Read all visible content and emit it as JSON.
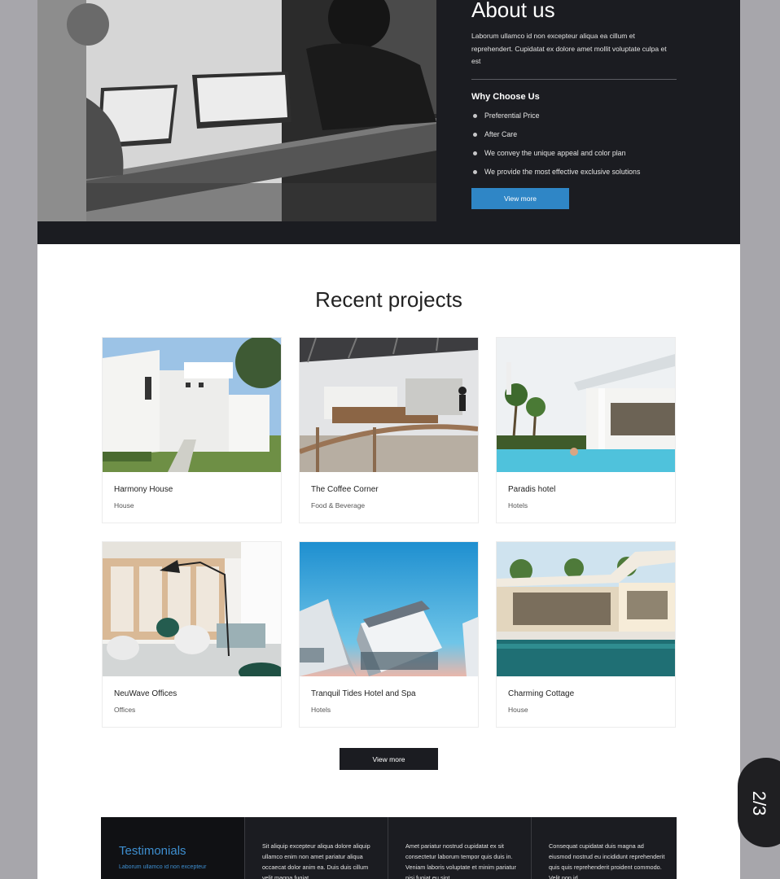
{
  "about": {
    "title": "About us",
    "text": "Laborum ullamco id non excepteur aliqua ea cillum et reprehendert. Cupidatat ex dolore amet mollit voluptate culpa et est",
    "why_title": "Why Choose Us",
    "why_items": [
      "Preferential Price",
      "After Care",
      "We convey the unique appeal and color plan",
      "We provide the most effective exclusive solutions"
    ],
    "button_label": "View more"
  },
  "projects": {
    "title": "Recent projects",
    "items": [
      {
        "name": "Harmony House",
        "category": "House"
      },
      {
        "name": "The Coffee Corner",
        "category": "Food & Beverage"
      },
      {
        "name": "Paradis hotel",
        "category": "Hotels"
      },
      {
        "name": "NeuWave Offices",
        "category": "Offices"
      },
      {
        "name": "Tranquil Tides Hotel and Spa",
        "category": "Hotels"
      },
      {
        "name": "Charming Cottage",
        "category": "House"
      }
    ],
    "button_label": "View more"
  },
  "testimonials": {
    "title": "Testimonials",
    "subtitle": "Laborum ullamco id non excepteur",
    "quotes": [
      "Sit aliquip excepteur aliqua dolore aliquip ullamco enim non amet pariatur aliqua occaecat dolor anim ea. Duis duis cillum velit magna fugiat",
      "Amet pariatur nostrud cupidatat ex sit consectetur laborum tempor quis duis in. Veniam laboris voluptate et minim pariatur nisi fugiat eu sint",
      "Consequat cupidatat duis magna ad eiusmod nostrud eu incididunt reprehenderit quis quis reprehenderit proident commodo. Velit non id"
    ]
  },
  "pager": {
    "label": "2/3"
  },
  "colors": {
    "dark": "#1b1c21",
    "accent": "#2f86c6",
    "accent_text": "#3e8fd0"
  }
}
